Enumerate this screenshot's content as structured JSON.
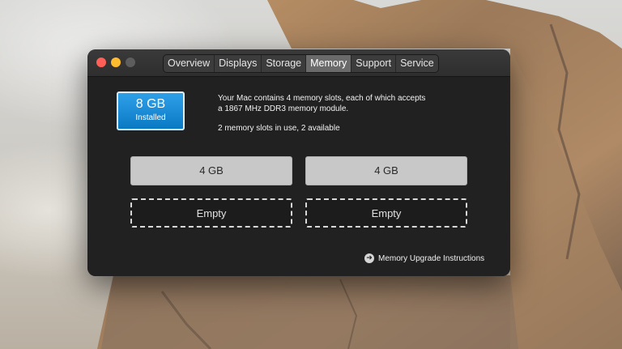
{
  "window": {
    "tabs": [
      {
        "label": "Overview"
      },
      {
        "label": "Displays"
      },
      {
        "label": "Storage"
      },
      {
        "label": "Memory",
        "active": true
      },
      {
        "label": "Support"
      },
      {
        "label": "Service"
      }
    ]
  },
  "memory": {
    "installed_size": "8 GB",
    "installed_label": "Installed",
    "description_line1": "Your Mac contains 4 memory slots, each of which accepts",
    "description_line2": "a 1867 MHz DDR3 memory module.",
    "slots_status": "2 memory slots in use, 2 available",
    "slots": [
      {
        "label": "4 GB",
        "state": "filled"
      },
      {
        "label": "4 GB",
        "state": "filled"
      },
      {
        "label": "Empty",
        "state": "empty"
      },
      {
        "label": "Empty",
        "state": "empty"
      }
    ],
    "upgrade_link": "Memory Upgrade Instructions",
    "upgrade_icon": "arrow-right-circle-icon"
  },
  "colors": {
    "badge_accent": "#1a8bd6",
    "close": "#fe5f57",
    "minimize": "#febc2e",
    "zoom_disabled": "#5d5d5d"
  }
}
